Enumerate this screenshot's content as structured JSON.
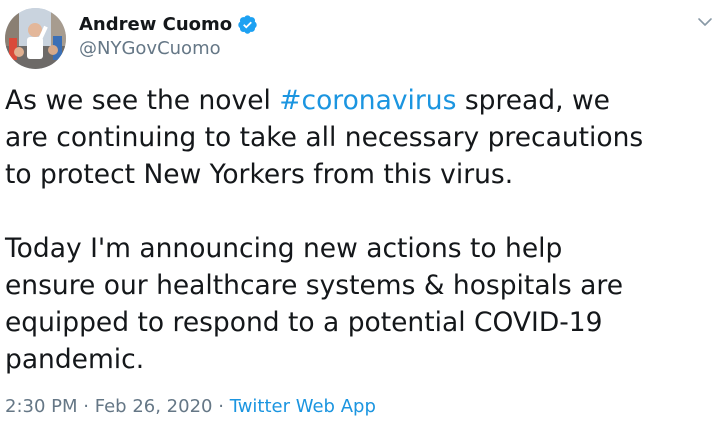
{
  "author": {
    "display_name": "Andrew Cuomo",
    "handle": "@NYGovCuomo"
  },
  "tweet": {
    "line1_pre": "As we see the novel ",
    "hashtag": "#coronavirus",
    "line1_post": " spread, we",
    "line2": "are continuing to take all necessary precautions",
    "line3": "to protect New Yorkers from this virus.",
    "line4": "Today I'm announcing new actions to help",
    "line5": "ensure our healthcare systems & hospitals are",
    "line6": "equipped to respond to a potential COVID-19",
    "line7": "pandemic."
  },
  "meta": {
    "time": "2:30 PM",
    "separator": "·",
    "date": "Feb 26, 2020",
    "source": "Twitter Web App"
  },
  "icons": {
    "verified": "verified-badge-icon",
    "caret": "chevron-down-icon"
  },
  "colors": {
    "link": "#1b95e0",
    "text": "#14171a",
    "muted": "#657786",
    "verified": "#1da1f2"
  }
}
